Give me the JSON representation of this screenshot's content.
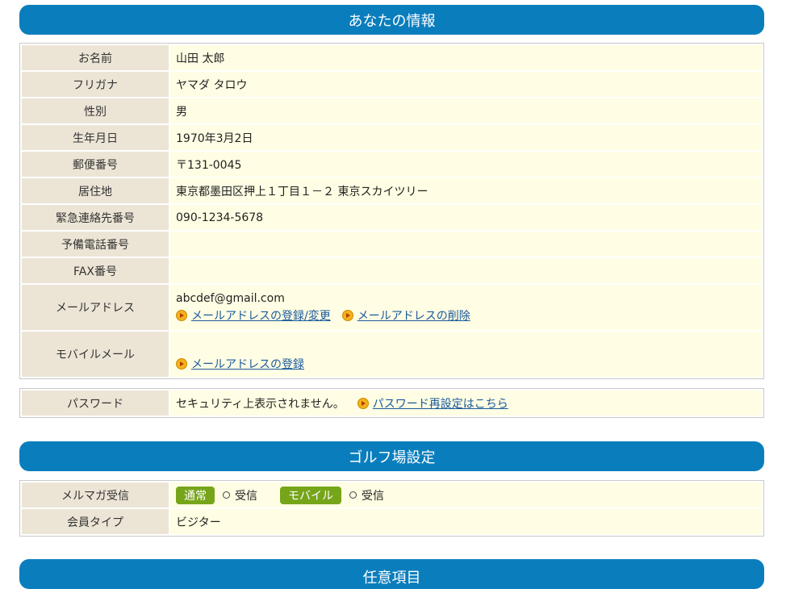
{
  "section1": {
    "title": "あなたの情報",
    "rows": [
      {
        "label": "お名前",
        "value": "山田 太郎"
      },
      {
        "label": "フリガナ",
        "value": "ヤマダ タロウ"
      },
      {
        "label": "性別",
        "value": "男"
      },
      {
        "label": "生年月日",
        "value": "1970年3月2日"
      },
      {
        "label": "郵便番号",
        "value": "〒131-0045"
      },
      {
        "label": "居住地",
        "value": "東京都墨田区押上１丁目１－２ 東京スカイツリー"
      },
      {
        "label": "緊急連絡先番号",
        "value": "090-1234-5678"
      },
      {
        "label": "予備電話番号",
        "value": ""
      },
      {
        "label": "FAX番号",
        "value": ""
      }
    ],
    "email": {
      "label": "メールアドレス",
      "value": "abcdef@gmail.com",
      "register_link": "メールアドレスの登録/変更",
      "delete_link": "メールアドレスの削除"
    },
    "mobile": {
      "label": "モバイルメール",
      "register_link": "メールアドレスの登録"
    }
  },
  "password": {
    "label": "パスワード",
    "value": "セキュリティ上表示されません。",
    "reset_link": "パスワード再設定はこちら"
  },
  "section2": {
    "title": "ゴルフ場設定",
    "newsletter": {
      "label": "メルマガ受信",
      "normal_badge": "通常",
      "normal_option": "受信",
      "mobile_badge": "モバイル",
      "mobile_option": "受信"
    },
    "member_type": {
      "label": "会員タイプ",
      "value": "ビジター"
    }
  },
  "section3": {
    "title": "任意項目"
  },
  "colors": {
    "header": "#0a7ebd",
    "label_bg": "#ece5d6",
    "value_bg": "#fffde3",
    "badge": "#76a51a",
    "link": "#1a5a9e"
  }
}
